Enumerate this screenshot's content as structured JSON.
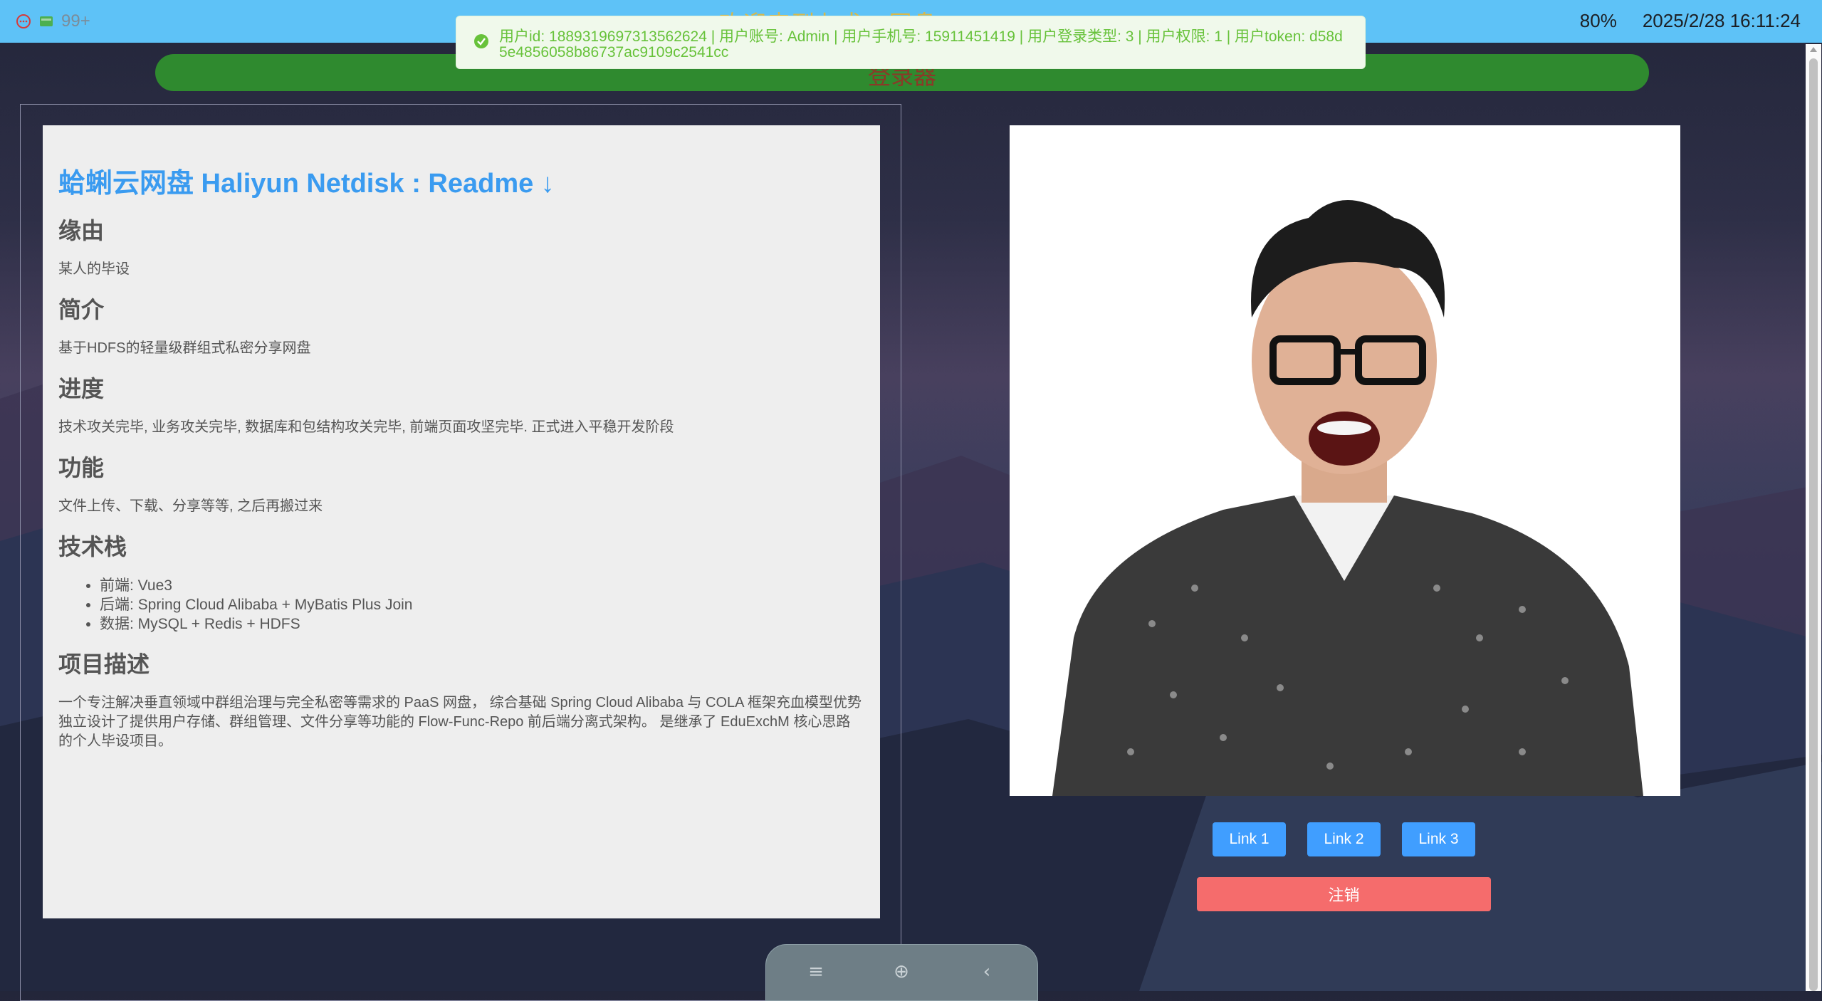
{
  "topbar": {
    "badge_count": "99+",
    "zoom": "80%",
    "datetime": "2025/2/28 16:11:24",
    "welcome": "欢迎来到七术 · 同盘"
  },
  "greenbar": {
    "title": "登录器"
  },
  "toast": {
    "message": "用户id: 1889319697313562624 | 用户账号: Admin | 用户手机号: 15911451419 | 用户登录类型: 3 | 用户权限: 1 | 用户token: d58d5e4856058b86737ac9109c2541cc"
  },
  "readme": {
    "title": "蛤蜊云网盘 Haliyun Netdisk : Readme ↓",
    "sections": [
      {
        "heading": "缘由",
        "text": "某人的毕设"
      },
      {
        "heading": "简介",
        "text": "基于HDFS的轻量级群组式私密分享网盘"
      },
      {
        "heading": "进度",
        "text": "技术攻关完毕, 业务攻关完毕, 数据库和包结构攻关完毕, 前端页面攻坚完毕. 正式进入平稳开发阶段"
      },
      {
        "heading": "功能",
        "text": "文件上传、下载、分享等等, 之后再搬过来"
      },
      {
        "heading": "技术栈",
        "items": [
          "前端: Vue3",
          "后端: Spring Cloud Alibaba + MyBatis Plus Join",
          "数据: MySQL + Redis + HDFS"
        ]
      },
      {
        "heading": "项目描述",
        "text": "一个专注解决垂直领域中群组治理与完全私密等需求的 PaaS 网盘， 综合基础 Spring Cloud Alibaba 与 COLA 框架充血模型优势独立设计了提供用户存储、群组管理、文件分享等功能的 Flow-Func-Repo 前后端分离式架构。 是继承了 EduExchM 核心思路的个人毕设项目。"
      }
    ]
  },
  "links": [
    "Link 1",
    "Link 2",
    "Link 3"
  ],
  "logout_label": "注销",
  "colors": {
    "topbar": "#5ec2f7",
    "link": "#409eff",
    "logout": "#f56c6c",
    "toast_text": "#67c23a",
    "title_blue": "#3a9bf0"
  }
}
